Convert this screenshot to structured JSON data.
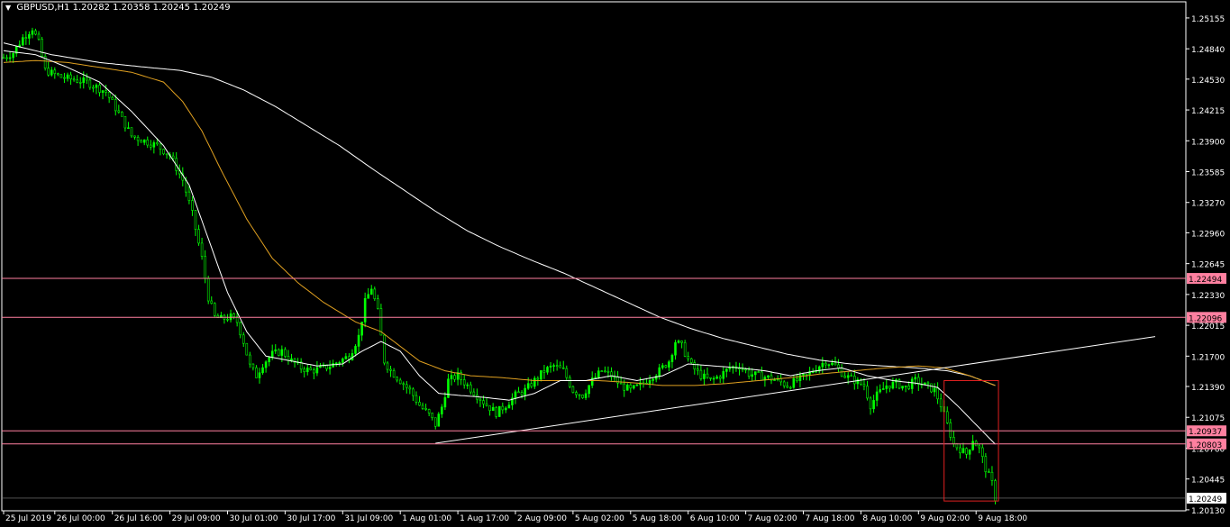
{
  "header": {
    "symbol": "GBPUSD,H1",
    "ohlc": "1.20282 1.20358 1.20245 1.20249",
    "menu_icon": "triangle-down-icon"
  },
  "colors": {
    "background": "#000000",
    "frame": "#ffffff",
    "candle": "#00ff00",
    "ma_fast": "#ffffff",
    "ma_medium": "#e0a020",
    "ma_slow": "#ffffff",
    "level_line": "#ff80a0",
    "level_label_bg": "#ff80a0",
    "trendline": "#ffffff",
    "box": "#e02020"
  },
  "chart_data": {
    "type": "candlestick",
    "instrument": "GBPUSD",
    "timeframe": "H1",
    "ylim": [
      1.2013,
      1.253
    ],
    "y_ticks": [
      "1.25155",
      "1.24840",
      "1.24530",
      "1.24215",
      "1.23900",
      "1.23585",
      "1.23270",
      "1.22960",
      "1.22645",
      "1.22330",
      "1.22015",
      "1.21700",
      "1.21390",
      "1.21075",
      "1.20760",
      "1.20445",
      "1.20130"
    ],
    "x_ticks": [
      "25 Jul 2019",
      "26 Jul 00:00",
      "26 Jul 16:00",
      "29 Jul 09:00",
      "30 Jul 01:00",
      "30 Jul 17:00",
      "31 Jul 09:00",
      "1 Aug 01:00",
      "1 Aug 17:00",
      "2 Aug 09:00",
      "5 Aug 02:00",
      "5 Aug 18:00",
      "6 Aug 10:00",
      "7 Aug 02:00",
      "7 Aug 18:00",
      "8 Aug 10:00",
      "9 Aug 02:00",
      "9 Aug 18:00"
    ],
    "price_path": [
      [
        0,
        1.2475
      ],
      [
        3,
        1.248
      ],
      [
        6,
        1.2495
      ],
      [
        9,
        1.2505
      ],
      [
        11,
        1.249
      ],
      [
        13,
        1.2462
      ],
      [
        18,
        1.2455
      ],
      [
        26,
        1.245
      ],
      [
        32,
        1.244
      ],
      [
        36,
        1.2418
      ],
      [
        40,
        1.2395
      ],
      [
        44,
        1.239
      ],
      [
        48,
        1.2385
      ],
      [
        52,
        1.2375
      ],
      [
        56,
        1.235
      ],
      [
        59,
        1.2315
      ],
      [
        62,
        1.227
      ],
      [
        64,
        1.223
      ],
      [
        66,
        1.221
      ],
      [
        68,
        1.2208
      ],
      [
        71,
        1.221
      ],
      [
        73,
        1.2205
      ],
      [
        75,
        1.2185
      ],
      [
        77,
        1.216
      ],
      [
        79,
        1.215
      ],
      [
        81,
        1.2162
      ],
      [
        84,
        1.2172
      ],
      [
        87,
        1.2175
      ],
      [
        90,
        1.2165
      ],
      [
        93,
        1.2158
      ],
      [
        96,
        1.2155
      ],
      [
        99,
        1.2157
      ],
      [
        102,
        1.216
      ],
      [
        105,
        1.2165
      ],
      [
        108,
        1.217
      ],
      [
        111,
        1.219
      ],
      [
        113,
        1.2225
      ],
      [
        115,
        1.224
      ],
      [
        117,
        1.2215
      ],
      [
        119,
        1.2165
      ],
      [
        121,
        1.2155
      ],
      [
        124,
        1.2145
      ],
      [
        127,
        1.2135
      ],
      [
        130,
        1.212
      ],
      [
        133,
        1.211
      ],
      [
        135,
        1.21
      ],
      [
        137,
        1.2118
      ],
      [
        139,
        1.2145
      ],
      [
        142,
        1.215
      ],
      [
        145,
        1.214
      ],
      [
        148,
        1.213
      ],
      [
        151,
        1.212
      ],
      [
        154,
        1.2112
      ],
      [
        157,
        1.212
      ],
      [
        160,
        1.213
      ],
      [
        163,
        1.2135
      ],
      [
        166,
        1.2145
      ],
      [
        169,
        1.2155
      ],
      [
        172,
        1.216
      ],
      [
        175,
        1.2155
      ],
      [
        178,
        1.2135
      ],
      [
        181,
        1.213
      ],
      [
        184,
        1.2145
      ],
      [
        187,
        1.2155
      ],
      [
        190,
        1.215
      ],
      [
        193,
        1.214
      ],
      [
        196,
        1.2135
      ],
      [
        199,
        1.214
      ],
      [
        202,
        1.2148
      ],
      [
        205,
        1.2155
      ],
      [
        208,
        1.2165
      ],
      [
        210,
        1.2185
      ],
      [
        212,
        1.218
      ],
      [
        215,
        1.216
      ],
      [
        218,
        1.215
      ],
      [
        221,
        1.2145
      ],
      [
        224,
        1.215
      ],
      [
        227,
        1.2158
      ],
      [
        230,
        1.216
      ],
      [
        233,
        1.2152
      ],
      [
        236,
        1.215
      ],
      [
        239,
        1.2148
      ],
      [
        242,
        1.2145
      ],
      [
        245,
        1.214
      ],
      [
        248,
        1.2145
      ],
      [
        251,
        1.215
      ],
      [
        254,
        1.2158
      ],
      [
        257,
        1.2165
      ],
      [
        260,
        1.216
      ],
      [
        263,
        1.215
      ],
      [
        266,
        1.2145
      ],
      [
        269,
        1.214
      ],
      [
        271,
        1.212
      ],
      [
        273,
        1.213
      ],
      [
        276,
        1.214
      ],
      [
        279,
        1.2142
      ],
      [
        282,
        1.2138
      ],
      [
        285,
        1.2145
      ],
      [
        288,
        1.214
      ],
      [
        291,
        1.2135
      ],
      [
        293,
        1.212
      ],
      [
        295,
        1.21
      ],
      [
        297,
        1.208
      ],
      [
        299,
        1.2075
      ],
      [
        301,
        1.207
      ],
      [
        303,
        1.2085
      ],
      [
        305,
        1.2075
      ],
      [
        307,
        1.2055
      ],
      [
        309,
        1.204
      ],
      [
        310,
        1.2025
      ]
    ],
    "ma_fast_path": [
      [
        0,
        1.2482
      ],
      [
        10,
        1.2478
      ],
      [
        20,
        1.2465
      ],
      [
        30,
        1.245
      ],
      [
        40,
        1.242
      ],
      [
        50,
        1.2385
      ],
      [
        58,
        1.2345
      ],
      [
        64,
        1.229
      ],
      [
        70,
        1.2235
      ],
      [
        76,
        1.2195
      ],
      [
        82,
        1.217
      ],
      [
        90,
        1.2165
      ],
      [
        98,
        1.216
      ],
      [
        106,
        1.2162
      ],
      [
        112,
        1.2175
      ],
      [
        118,
        1.2185
      ],
      [
        124,
        1.2175
      ],
      [
        130,
        1.215
      ],
      [
        136,
        1.2132
      ],
      [
        142,
        1.213
      ],
      [
        150,
        1.2128
      ],
      [
        158,
        1.2125
      ],
      [
        166,
        1.2132
      ],
      [
        174,
        1.2145
      ],
      [
        182,
        1.2145
      ],
      [
        190,
        1.215
      ],
      [
        198,
        1.2145
      ],
      [
        206,
        1.215
      ],
      [
        214,
        1.2162
      ],
      [
        222,
        1.216
      ],
      [
        230,
        1.2158
      ],
      [
        238,
        1.2155
      ],
      [
        246,
        1.215
      ],
      [
        254,
        1.2155
      ],
      [
        262,
        1.2158
      ],
      [
        270,
        1.215
      ],
      [
        278,
        1.2145
      ],
      [
        286,
        1.2142
      ],
      [
        292,
        1.2138
      ],
      [
        298,
        1.212
      ],
      [
        304,
        1.21
      ],
      [
        310,
        1.208
      ]
    ],
    "ma_medium_path": [
      [
        0,
        1.247
      ],
      [
        10,
        1.2472
      ],
      [
        20,
        1.247
      ],
      [
        30,
        1.2465
      ],
      [
        40,
        1.246
      ],
      [
        50,
        1.245
      ],
      [
        56,
        1.243
      ],
      [
        62,
        1.24
      ],
      [
        68,
        1.236
      ],
      [
        76,
        1.231
      ],
      [
        84,
        1.227
      ],
      [
        92,
        1.2245
      ],
      [
        100,
        1.2225
      ],
      [
        110,
        1.2205
      ],
      [
        118,
        1.2195
      ],
      [
        124,
        1.218
      ],
      [
        130,
        1.2165
      ],
      [
        138,
        1.2155
      ],
      [
        146,
        1.215
      ],
      [
        156,
        1.2148
      ],
      [
        166,
        1.2145
      ],
      [
        176,
        1.2145
      ],
      [
        186,
        1.2145
      ],
      [
        196,
        1.2143
      ],
      [
        206,
        1.214
      ],
      [
        216,
        1.214
      ],
      [
        226,
        1.2142
      ],
      [
        236,
        1.2145
      ],
      [
        246,
        1.2148
      ],
      [
        256,
        1.2152
      ],
      [
        266,
        1.2155
      ],
      [
        276,
        1.2158
      ],
      [
        286,
        1.216
      ],
      [
        294,
        1.2158
      ],
      [
        302,
        1.215
      ],
      [
        310,
        1.214
      ]
    ],
    "ma_slow_path": [
      [
        0,
        1.249
      ],
      [
        15,
        1.2478
      ],
      [
        30,
        1.247
      ],
      [
        45,
        1.2465
      ],
      [
        55,
        1.2462
      ],
      [
        65,
        1.2455
      ],
      [
        75,
        1.2442
      ],
      [
        85,
        1.2425
      ],
      [
        95,
        1.2405
      ],
      [
        105,
        1.2385
      ],
      [
        115,
        1.2362
      ],
      [
        125,
        1.234
      ],
      [
        135,
        1.2318
      ],
      [
        145,
        1.2298
      ],
      [
        155,
        1.2282
      ],
      [
        165,
        1.2268
      ],
      [
        175,
        1.2255
      ],
      [
        185,
        1.224
      ],
      [
        195,
        1.2225
      ],
      [
        205,
        1.221
      ],
      [
        215,
        1.2198
      ],
      [
        225,
        1.2188
      ],
      [
        235,
        1.218
      ],
      [
        245,
        1.2172
      ],
      [
        255,
        1.2166
      ],
      [
        265,
        1.2162
      ],
      [
        275,
        1.216
      ],
      [
        285,
        1.2158
      ],
      [
        295,
        1.2155
      ],
      [
        302,
        1.215
      ],
      [
        310,
        1.214
      ]
    ],
    "levels": [
      {
        "label": "1.22494",
        "value": 1.22494
      },
      {
        "label": "1.22096",
        "value": 1.22096
      },
      {
        "label": "1.20937",
        "value": 1.20937
      },
      {
        "label": "1.20803",
        "value": 1.20803
      }
    ],
    "current_price_label": "1.20249",
    "current_price": 1.20249,
    "trendline": {
      "from": [
        135,
        1.2081
      ],
      "to": [
        360,
        1.219
      ]
    },
    "box": {
      "from": [
        294,
        1.2145
      ],
      "to": [
        311,
        1.2022
      ]
    },
    "bars_total": 310
  }
}
